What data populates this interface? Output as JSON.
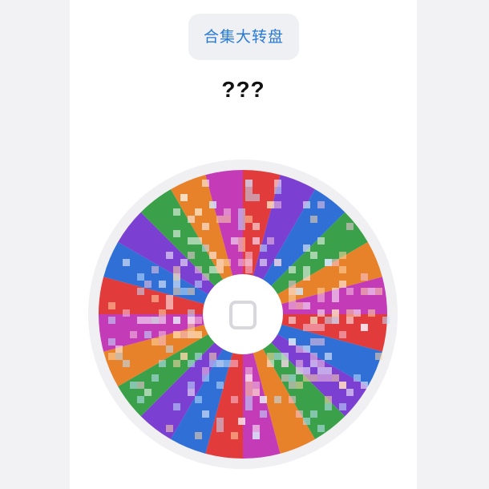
{
  "header": {
    "collection_button_label": "合集大转盘"
  },
  "result": {
    "text": "???"
  },
  "wheel": {
    "segment_colors": [
      "#e23b3b",
      "#7b3fd1",
      "#2f6fd6",
      "#3aa14a",
      "#e8822a",
      "#c43bb8",
      "#e23b3b",
      "#2f6fd6",
      "#7b3fd1",
      "#3aa14a",
      "#e8822a",
      "#c43bb8",
      "#e23b3b",
      "#2f6fd6",
      "#7b3fd1",
      "#3aa14a",
      "#e8822a",
      "#c43bb8",
      "#e23b3b",
      "#2f6fd6",
      "#7b3fd1",
      "#3aa14a",
      "#e8822a",
      "#c43bb8"
    ],
    "rim_color": "#f0f0f2",
    "hub_color": "#ffffff",
    "hub_icon": "square-outline-icon"
  },
  "colors": {
    "background": "#f2f2f4",
    "panel": "#ffffff",
    "accent": "#2a7ad5",
    "text": "#111111"
  }
}
